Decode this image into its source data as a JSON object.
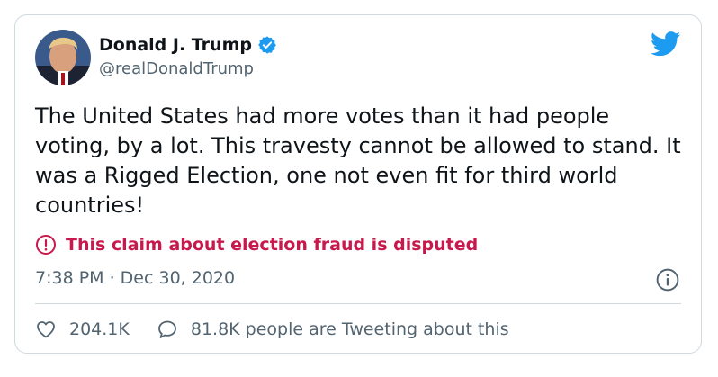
{
  "tweet": {
    "author_name": "Donald J. Trump",
    "author_handle": "@realDonaldTrump",
    "text": "The United States had more votes than it had people voting, by a lot. This travesty cannot be allowed to stand. It was a Rigged Election, one not even fit for third world countries!",
    "warning": "This claim about election fraud is disputed",
    "timestamp": "7:38 PM · Dec 30, 2020",
    "likes": "204.1K",
    "discussion": "81.8K people are Tweeting about this"
  },
  "icons": {
    "verified": "verified-badge-icon",
    "bird": "twitter-bird-icon",
    "warning": "exclamation-circle-icon",
    "info": "info-icon",
    "like": "heart-icon",
    "reply": "speech-bubble-icon"
  },
  "colors": {
    "brand": "#1d9bf0",
    "warning": "#c8194d",
    "secondary_text": "#536471",
    "border": "#cfd9de"
  }
}
